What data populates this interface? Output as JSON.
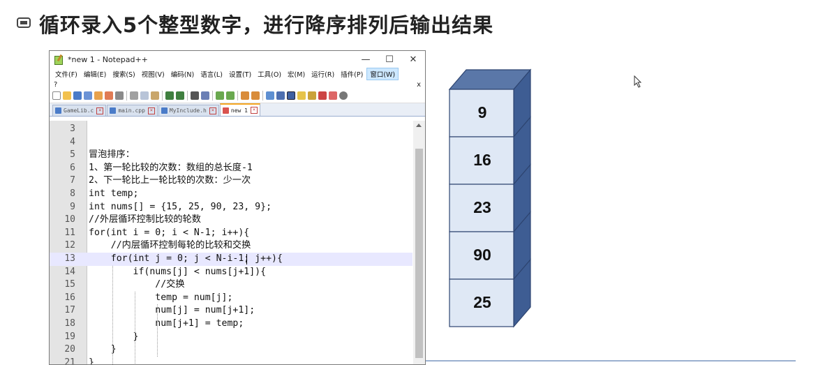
{
  "slide": {
    "title": "循环录入5个整型数字，进行降序排列后输出结果"
  },
  "window": {
    "title": "*new 1 - Notepad++",
    "controls": [
      "—",
      "☐",
      "✕"
    ]
  },
  "menu": {
    "items": [
      "文件(F)",
      "编辑(E)",
      "搜索(S)",
      "视图(V)",
      "编码(N)",
      "语言(L)",
      "设置(T)",
      "工具(O)",
      "宏(M)",
      "运行(R)",
      "插件(P)",
      "窗口(W)"
    ],
    "help": "?",
    "close": "x"
  },
  "tabs": [
    {
      "label": "GameLib.c",
      "active": false
    },
    {
      "label": "main.cpp",
      "active": false
    },
    {
      "label": "MyInclude.h",
      "active": false
    },
    {
      "label": "new 1",
      "active": true
    }
  ],
  "editor": {
    "lines": [
      {
        "n": "3",
        "text": ""
      },
      {
        "n": "4",
        "text": ""
      },
      {
        "n": "5",
        "text": "冒泡排序："
      },
      {
        "n": "6",
        "text": "1、第一轮比较的次数：数组的总长度-1"
      },
      {
        "n": "7",
        "text": "2、下一轮比上一轮比较的次数：少一次"
      },
      {
        "n": "8",
        "text": "int temp;"
      },
      {
        "n": "9",
        "text": "int nums[] = {15, 25, 90, 23, 9};"
      },
      {
        "n": "10",
        "text": "//外层循环控制比较的轮数"
      },
      {
        "n": "11",
        "text": "for(int i = 0; i < N-1; i++){"
      },
      {
        "n": "12",
        "text": "    //内层循环控制每轮的比较和交换"
      },
      {
        "n": "13",
        "text": "    for(int j = 0; j < N-i-1; j++){"
      },
      {
        "n": "14",
        "text": "        if(nums[j] < nums[j+1]){"
      },
      {
        "n": "15",
        "text": "            //交换"
      },
      {
        "n": "16",
        "text": "            temp = num[j];"
      },
      {
        "n": "17",
        "text": "            num[j] = num[j+1];"
      },
      {
        "n": "18",
        "text": "            num[j+1] = temp;"
      },
      {
        "n": "19",
        "text": "        }"
      },
      {
        "n": "20",
        "text": "    }"
      },
      {
        "n": "21",
        "text": "}"
      }
    ],
    "current_line": "13"
  },
  "stack": {
    "values": [
      "9",
      "16",
      "23",
      "90",
      "25"
    ],
    "colors": {
      "front": "#dfe8f5",
      "top": "#5a77a8",
      "side": "#3e5d93",
      "topFace": "#5a77a8"
    }
  }
}
